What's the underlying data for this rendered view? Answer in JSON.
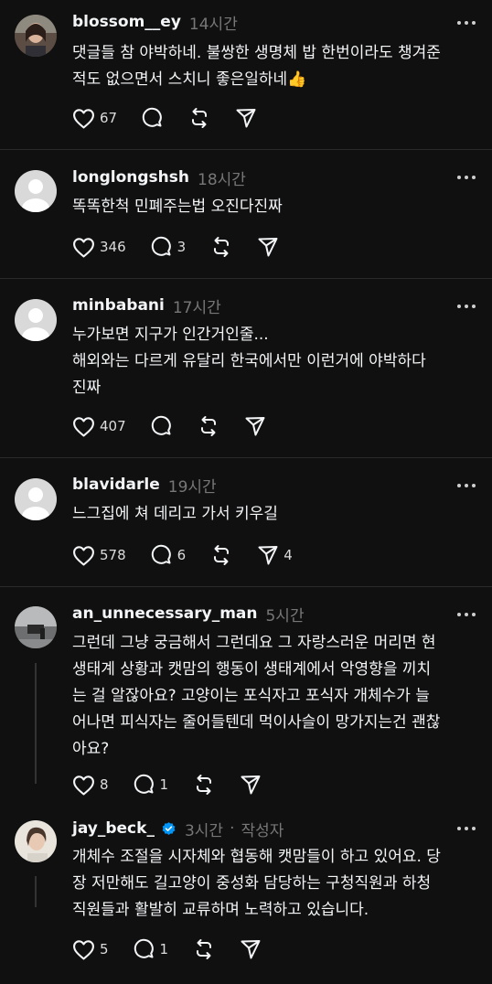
{
  "posts": [
    {
      "username": "blossom__ey",
      "time": "14시간",
      "text": "댓글들 참 야박하네. 불쌍한 생명체 밥 한번이라도 챙겨준\n적도 없으면서 스치니 좋은일하네👍",
      "likes": "67",
      "replies": "",
      "reposts": "",
      "shares": ""
    },
    {
      "username": "longlongshsh",
      "time": "18시간",
      "text": "똑똑한척 민폐주는법 오진다진짜",
      "likes": "346",
      "replies": "3",
      "reposts": "",
      "shares": ""
    },
    {
      "username": "minbabani",
      "time": "17시간",
      "text": "누가보면 지구가 인간거인줄...\n해외와는 다르게 유달리 한국에서만 이런거에 야박하다\n진짜",
      "likes": "407",
      "replies": "",
      "reposts": "",
      "shares": ""
    },
    {
      "username": "blavidarle",
      "time": "19시간",
      "text": "느그집에 쳐 데리고 가서 키우길",
      "likes": "578",
      "replies": "6",
      "reposts": "",
      "shares": "4"
    },
    {
      "username": "an_unnecessary_man",
      "time": "5시간",
      "text": "그런데 그냥 궁금해서 그런데요 그 자랑스러운 머리면 현\n생태계 상황과 캣맘의 행동이 생태계에서 악영향을 끼치\n는 걸 알잖아요? 고양이는 포식자고 포식자 개체수가 늘\n어나면 피식자는 줄어들텐데 먹이사슬이 망가지는건 괜찮\n아요?",
      "likes": "8",
      "replies": "1",
      "reposts": "",
      "shares": ""
    },
    {
      "username": "jay_beck_",
      "time": "3시간",
      "author_dot": "·",
      "author_label": "작성자",
      "text": "개체수 조절을 시자체와 협동해 캣맘들이 하고 있어요. 당\n장 저만해도 길고양이 중성화 담당하는 구청직원과 하청\n직원들과 활발히 교류하며 노력하고 있습니다.",
      "likes": "5",
      "replies": "1",
      "reposts": "",
      "shares": ""
    }
  ],
  "icons": {
    "like": "heart-icon",
    "reply": "comment-bubble-icon",
    "repost": "repost-icon",
    "share": "send-icon",
    "more": "more-dots-icon",
    "verified": "verified-badge-icon"
  },
  "colors": {
    "background": "#101010",
    "text": "#f3f5f7",
    "muted": "#777777",
    "verified": "#0095f6",
    "divider": "#2a2a2a"
  }
}
